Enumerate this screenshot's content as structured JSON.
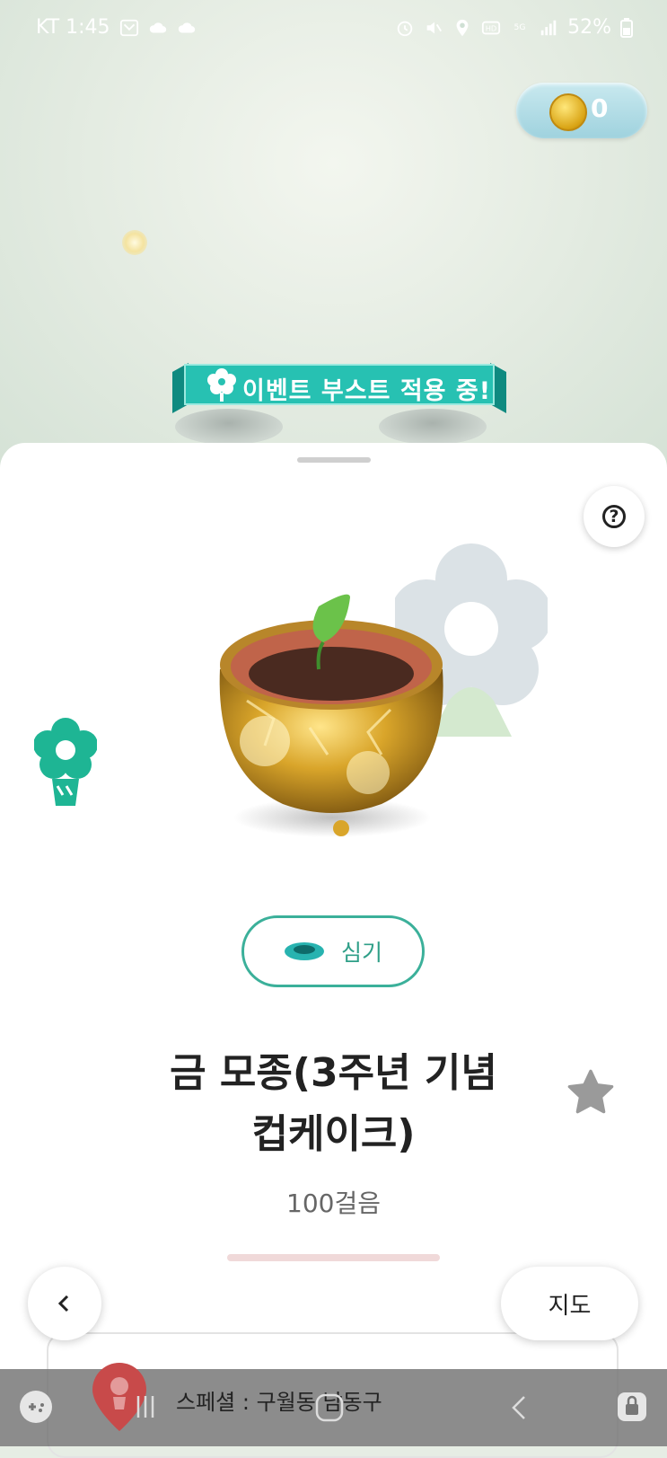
{
  "status_bar": {
    "carrier_time": "KT 1:45",
    "battery": "52%"
  },
  "coins": {
    "count": "0"
  },
  "event_banner": {
    "text": "이벤트 부스트 적용 중!"
  },
  "item": {
    "plant_button_label": "심기",
    "title_line1": "금 모종(3주년 기념",
    "title_line2": "컵케이크)",
    "steps": "100걸음"
  },
  "nav": {
    "map_button_label": "지도"
  },
  "location_bar": {
    "text": "스페셜 : 구월동 남동구"
  },
  "colors": {
    "accent": "#2f9f88",
    "teal_banner": "#1fb5a6",
    "coin_gold": "#d9a415"
  }
}
